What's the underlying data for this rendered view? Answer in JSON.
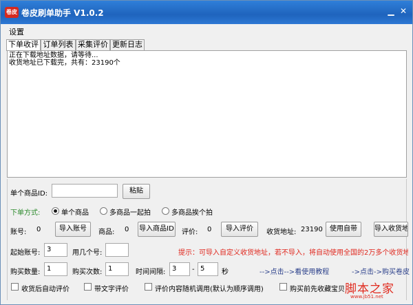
{
  "window": {
    "logo_text": "卷皮",
    "title": "卷皮刷单助手 V1.0.2",
    "min_glyph": "▁",
    "close_glyph": "✕"
  },
  "menu": {
    "settings": "设置"
  },
  "tabs": [
    {
      "label": "下单收评",
      "active": true
    },
    {
      "label": "订单列表",
      "active": false
    },
    {
      "label": "采集评价",
      "active": false
    },
    {
      "label": "更新日志",
      "active": false
    }
  ],
  "log": {
    "lines": [
      "正在下载地址数据，请等待...",
      "收货地址已下载完，共有：23190个"
    ]
  },
  "single_item": {
    "label": "单个商品ID:",
    "value": "",
    "paste_button": "粘贴"
  },
  "order_mode": {
    "label": "下单方式:",
    "options": [
      {
        "label": "单个商品",
        "selected": true
      },
      {
        "label": "多商品一起拍",
        "selected": false
      },
      {
        "label": "多商品挨个拍",
        "selected": false
      }
    ]
  },
  "imports": {
    "account_label": "账号:",
    "account_count": "0",
    "account_button": "导入账号",
    "product_label": "商品:",
    "product_count": "0",
    "product_button": "导入商品ID",
    "review_label": "评价:",
    "review_count": "0",
    "review_button": "导入评价",
    "address_label": "收货地址:",
    "address_count": "23190",
    "use_builtin_button": "使用自带",
    "import_address_button": "导入收货地"
  },
  "accounts": {
    "start_label": "起始账号:",
    "start_value": "3",
    "use_count_label": "用几个号:",
    "use_count_value": "",
    "hint": "提示：可导入自定义收货地址，若不导入，将自动使用全国的2万多个收货地"
  },
  "purchase": {
    "qty_label": "购买数量:",
    "qty_value": "1",
    "times_label": "购买次数:",
    "times_value": "1",
    "interval_label": "时间间隔:",
    "interval_from": "3",
    "interval_dash": "-",
    "interval_to": "5",
    "interval_unit": "秒",
    "tutorial_link": "-->点击-->看使用教程",
    "juanpi_link": "->点击->购买卷皮"
  },
  "options": [
    {
      "label": "收货后自动评价",
      "checked": false
    },
    {
      "label": "带文字评价",
      "checked": false
    },
    {
      "label": "评价内容随机调用(默认为顺序调用)",
      "checked": false
    },
    {
      "label": "购买前先收藏宝贝",
      "checked": false
    }
  ],
  "watermark": {
    "main": "脚本之家",
    "sub": "www.jb51.net"
  }
}
